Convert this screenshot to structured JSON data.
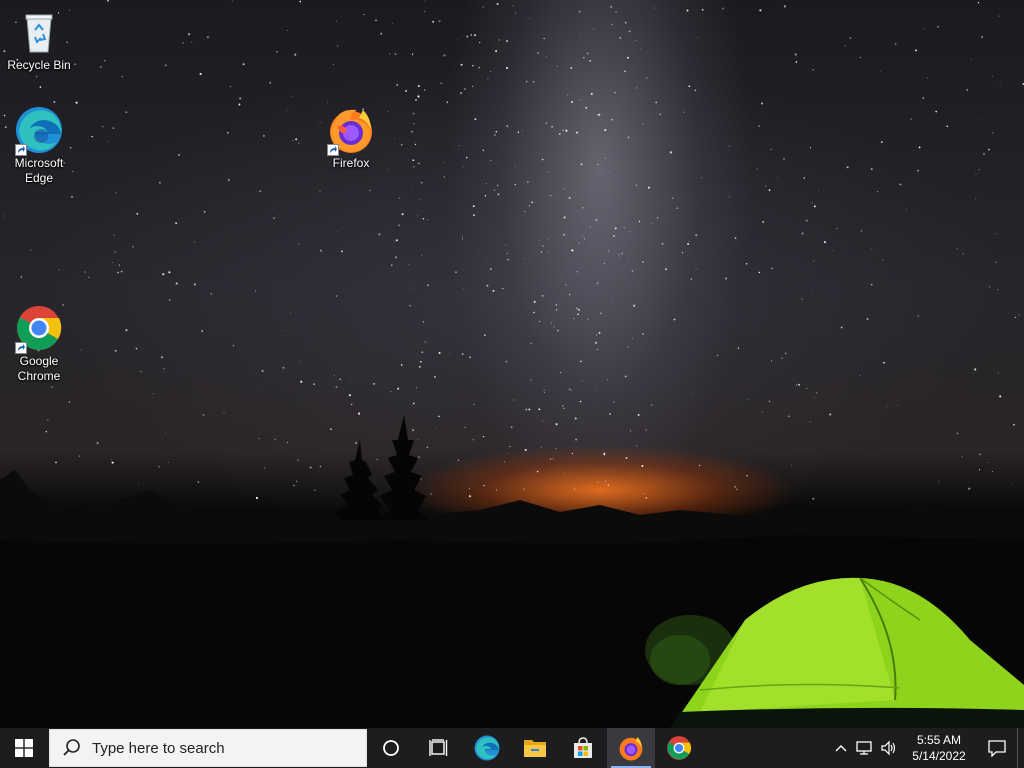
{
  "desktop": {
    "icons": {
      "recycle_bin": {
        "label": "Recycle Bin"
      },
      "edge": {
        "label": "Microsoft Edge"
      },
      "firefox": {
        "label": "Firefox"
      },
      "chrome": {
        "label": "Google Chrome"
      }
    }
  },
  "taskbar": {
    "search": {
      "placeholder": "Type here to search"
    },
    "pinned": [
      "cortana-icon",
      "task-view-icon",
      "edge-icon",
      "file-explorer-icon",
      "store-icon",
      "firefox-icon",
      "chrome-icon"
    ],
    "active_app": "firefox",
    "clock": {
      "time": "5:55 AM",
      "date": "5/14/2022"
    },
    "colors": {
      "bar": "#1d1d20",
      "accent": "#8ab4f8"
    }
  }
}
